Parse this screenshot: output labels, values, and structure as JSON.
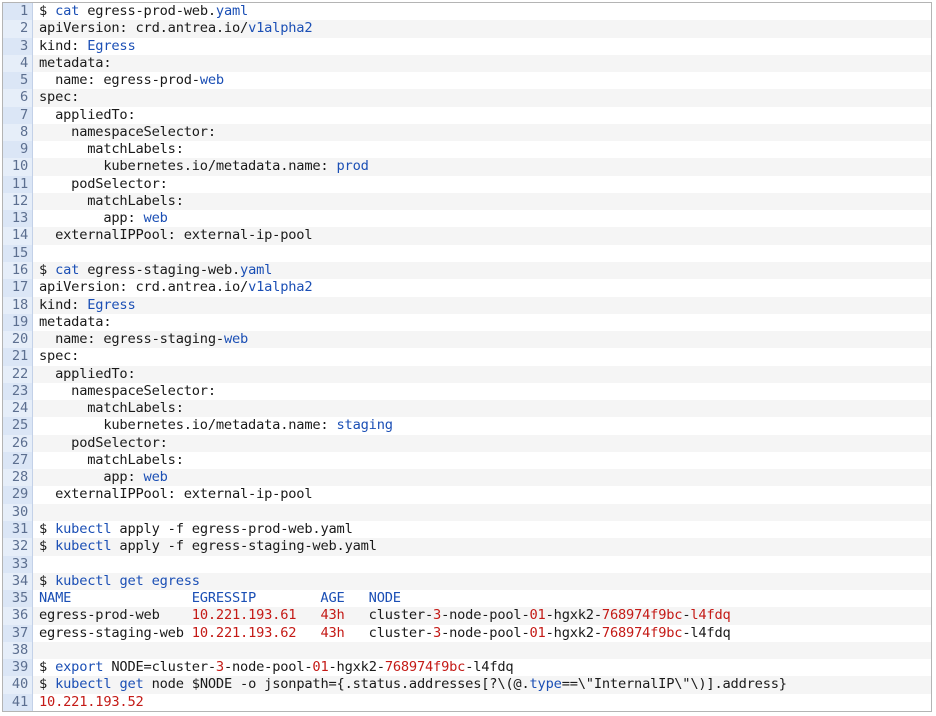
{
  "colors": {
    "keyword": "#1b4fb5",
    "number": "#c41a16",
    "gutter": "#dbe6f6",
    "text": "#1a1a1a"
  },
  "lines": [
    [
      [
        "$ ",
        ""
      ],
      [
        "cat",
        "kw"
      ],
      [
        " egress-prod-web.",
        ""
      ],
      [
        "yaml",
        "kw"
      ]
    ],
    [
      [
        "apiVersion: crd.antrea.io/",
        ""
      ],
      [
        "v1alpha2",
        "kw"
      ]
    ],
    [
      [
        "kind: ",
        ""
      ],
      [
        "Egress",
        "kw"
      ]
    ],
    [
      [
        "metadata:",
        ""
      ]
    ],
    [
      [
        "  name: egress-prod-",
        ""
      ],
      [
        "web",
        "kw"
      ]
    ],
    [
      [
        "spec:",
        ""
      ]
    ],
    [
      [
        "  appliedTo:",
        ""
      ]
    ],
    [
      [
        "    namespaceSelector:",
        ""
      ]
    ],
    [
      [
        "      matchLabels:",
        ""
      ]
    ],
    [
      [
        "        kubernetes.io/metadata.name: ",
        ""
      ],
      [
        "prod",
        "kw"
      ]
    ],
    [
      [
        "    podSelector:",
        ""
      ]
    ],
    [
      [
        "      matchLabels:",
        ""
      ]
    ],
    [
      [
        "        app: ",
        ""
      ],
      [
        "web",
        "kw"
      ]
    ],
    [
      [
        "  externalIPPool: external-ip-pool",
        ""
      ]
    ],
    [],
    [
      [
        "$ ",
        ""
      ],
      [
        "cat",
        "kw"
      ],
      [
        " egress-staging-web.",
        ""
      ],
      [
        "yaml",
        "kw"
      ]
    ],
    [
      [
        "apiVersion: crd.antrea.io/",
        ""
      ],
      [
        "v1alpha2",
        "kw"
      ]
    ],
    [
      [
        "kind: ",
        ""
      ],
      [
        "Egress",
        "kw"
      ]
    ],
    [
      [
        "metadata:",
        ""
      ]
    ],
    [
      [
        "  name: egress-staging-",
        ""
      ],
      [
        "web",
        "kw"
      ]
    ],
    [
      [
        "spec:",
        ""
      ]
    ],
    [
      [
        "  appliedTo:",
        ""
      ]
    ],
    [
      [
        "    namespaceSelector:",
        ""
      ]
    ],
    [
      [
        "      matchLabels:",
        ""
      ]
    ],
    [
      [
        "        kubernetes.io/metadata.name: ",
        ""
      ],
      [
        "staging",
        "kw"
      ]
    ],
    [
      [
        "    podSelector:",
        ""
      ]
    ],
    [
      [
        "      matchLabels:",
        ""
      ]
    ],
    [
      [
        "        app: ",
        ""
      ],
      [
        "web",
        "kw"
      ]
    ],
    [
      [
        "  externalIPPool: external-ip-pool",
        ""
      ]
    ],
    [],
    [
      [
        "$ ",
        ""
      ],
      [
        "kubectl",
        "kw"
      ],
      [
        " apply -f egress-prod-web.yaml",
        ""
      ]
    ],
    [
      [
        "$ ",
        ""
      ],
      [
        "kubectl",
        "kw"
      ],
      [
        " apply -f egress-staging-web.yaml",
        ""
      ]
    ],
    [],
    [
      [
        "$ ",
        ""
      ],
      [
        "kubectl",
        "kw"
      ],
      [
        " ",
        ""
      ],
      [
        "get",
        "kw"
      ],
      [
        " ",
        ""
      ],
      [
        "egress",
        "kw"
      ]
    ],
    [
      [
        "NAME               EGRESSIP        AGE   NODE",
        "kw"
      ]
    ],
    [
      [
        "egress-prod-web    ",
        ""
      ],
      [
        "10.221.193.61",
        "num"
      ],
      [
        "   ",
        ""
      ],
      [
        "43h",
        "num"
      ],
      [
        "   cluster-",
        ""
      ],
      [
        "3",
        "num"
      ],
      [
        "-node-pool-",
        ""
      ],
      [
        "01",
        "num"
      ],
      [
        "-hgxk2-",
        ""
      ],
      [
        "768974f9bc",
        "num"
      ],
      [
        "-",
        ""
      ],
      [
        "l4fdq",
        "num"
      ]
    ],
    [
      [
        "egress-staging-web ",
        ""
      ],
      [
        "10.221.193.62",
        "num"
      ],
      [
        "   ",
        ""
      ],
      [
        "43h",
        "num"
      ],
      [
        "   cluster-",
        ""
      ],
      [
        "3",
        "num"
      ],
      [
        "-node-pool-",
        ""
      ],
      [
        "01",
        "num"
      ],
      [
        "-hgxk2-",
        ""
      ],
      [
        "768974f9bc",
        "num"
      ],
      [
        "-l4fdq",
        ""
      ]
    ],
    [],
    [
      [
        "$ ",
        ""
      ],
      [
        "export",
        "kw"
      ],
      [
        " NODE=cluster-",
        ""
      ],
      [
        "3",
        "num"
      ],
      [
        "-node-pool-",
        ""
      ],
      [
        "01",
        "num"
      ],
      [
        "-hgxk2-",
        ""
      ],
      [
        "768974f9bc",
        "num"
      ],
      [
        "-l4fdq",
        ""
      ]
    ],
    [
      [
        "$ ",
        ""
      ],
      [
        "kubectl",
        "kw"
      ],
      [
        " ",
        ""
      ],
      [
        "get",
        "kw"
      ],
      [
        " node $NODE -o jsonpath={.status.addresses[?\\(@.",
        ""
      ],
      [
        "type",
        "kw"
      ],
      [
        "==\\\"InternalIP\\\"\\)].address}",
        ""
      ]
    ],
    [
      [
        "10.221.193.52",
        "num"
      ]
    ]
  ]
}
